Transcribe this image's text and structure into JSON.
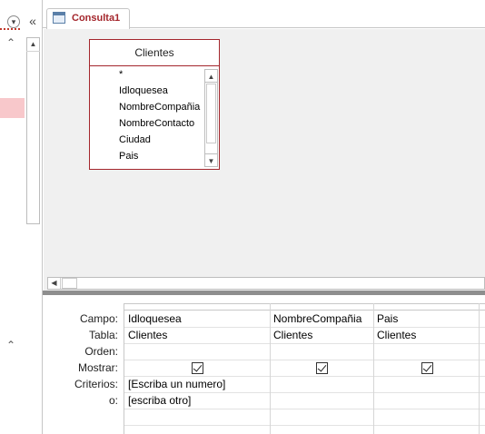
{
  "nav": {
    "dropdown_icon": "chevron-down-circle",
    "collapse_icon": "double-chevron-left",
    "collapse_glyph": "«",
    "dropdown_glyph": "▾",
    "up_glyph": "⌃",
    "scroll_up_glyph": "▲"
  },
  "tab": {
    "title": "Consulta1"
  },
  "table": {
    "name": "Clientes",
    "fields": [
      "*",
      "Idloquesea",
      "NombreCompañia",
      "NombreContacto",
      "Ciudad",
      "Pais"
    ],
    "scroll_up_glyph": "▲",
    "scroll_down_glyph": "▼"
  },
  "hscroll": {
    "left_glyph": "◀"
  },
  "grid": {
    "row_labels": {
      "campo": "Campo:",
      "tabla": "Tabla:",
      "orden": "Orden:",
      "mostrar": "Mostrar:",
      "criterios": "Criterios:",
      "o": "o:"
    },
    "columns": [
      {
        "campo": "Idloquesea",
        "tabla": "Clientes",
        "orden": "",
        "mostrar": true,
        "criterios": "[Escriba un numero]",
        "o": "[escriba otro]"
      },
      {
        "campo": "NombreCompañia",
        "tabla": "Clientes",
        "orden": "",
        "mostrar": true,
        "criterios": "",
        "o": ""
      },
      {
        "campo": "Pais",
        "tabla": "Clientes",
        "orden": "",
        "mostrar": true,
        "criterios": "",
        "o": ""
      }
    ]
  },
  "colors": {
    "accent": "#a4262c",
    "selection": "#f8c8cb",
    "surface": "#f0f0f0"
  }
}
